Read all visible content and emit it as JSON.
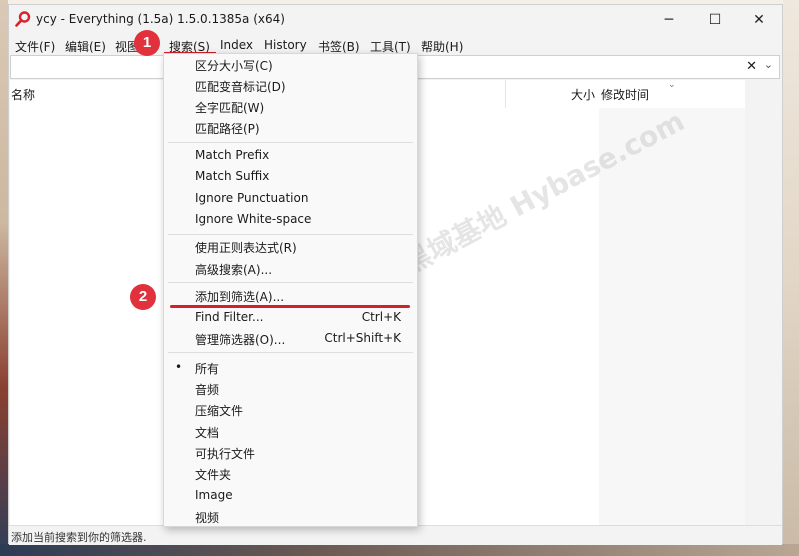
{
  "window": {
    "title": "ycy - Everything (1.5a) 1.5.0.1385a (x64)",
    "minimize_glyph": "─",
    "maximize_glyph": "☐",
    "close_glyph": "✕"
  },
  "menubar": {
    "items": [
      "文件(F)",
      "编辑(E)",
      "视图",
      "搜索(S)",
      "Index",
      "History",
      "书签(B)",
      "工具(T)",
      "帮助(H)"
    ]
  },
  "search": {
    "value": "",
    "placeholder": "",
    "clear_glyph": "✕",
    "dropdown_glyph": "⌄"
  },
  "columns": {
    "name": "名称",
    "size": "大小",
    "modified": "修改时间",
    "sort_glyph": "⌄"
  },
  "status": {
    "text": "添加当前搜索到你的筛选器."
  },
  "watermark": "记得收藏:黑域基地  Hybase.com",
  "callouts": [
    "1",
    "2"
  ],
  "search_menu": {
    "items": [
      {
        "label": "区分大小写(C)"
      },
      {
        "label": "匹配变音标记(D)"
      },
      {
        "label": "全字匹配(W)"
      },
      {
        "label": "匹配路径(P)"
      },
      {
        "label": "Match Prefix"
      },
      {
        "label": "Match Suffix"
      },
      {
        "label": "Ignore Punctuation"
      },
      {
        "label": "Ignore White-space"
      },
      {
        "label": "使用正则表达式(R)"
      },
      {
        "label": "高级搜索(A)..."
      },
      {
        "label": "添加到筛选(A)..."
      },
      {
        "label": "Find Filter...",
        "shortcut": "Ctrl+K"
      },
      {
        "label": "管理筛选器(O)...",
        "shortcut": "Ctrl+Shift+K"
      },
      {
        "label": "所有",
        "bullet": "•"
      },
      {
        "label": "音频"
      },
      {
        "label": "压缩文件"
      },
      {
        "label": "文档"
      },
      {
        "label": "可执行文件"
      },
      {
        "label": "文件夹"
      },
      {
        "label": "Image"
      },
      {
        "label": "视频"
      }
    ]
  },
  "colors": {
    "accent_red": "#e0313d",
    "underline_red": "#d3202a"
  }
}
